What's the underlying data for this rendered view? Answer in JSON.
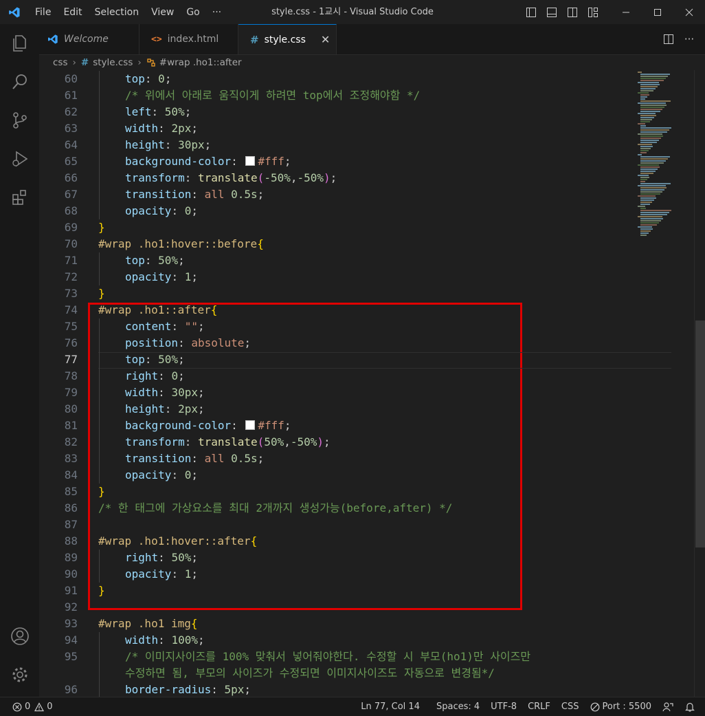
{
  "titlebar": {
    "menu": [
      "File",
      "Edit",
      "Selection",
      "View",
      "Go",
      "···"
    ],
    "window_title": "style.css - 1교시 - Visual Studio Code"
  },
  "tabs": [
    {
      "label": "Welcome",
      "icon": "vscode-logo-icon",
      "italic": true
    },
    {
      "label": "index.html",
      "icon": "html-file-icon"
    },
    {
      "label": "style.css",
      "icon": "css-file-icon",
      "active": true,
      "close": "✕"
    }
  ],
  "breadcrumb": {
    "folder": "css",
    "file": "style.css",
    "symbol": "#wrap .ho1::after"
  },
  "status": {
    "errors": "0",
    "warnings": "0",
    "position": "Ln 77, Col 14",
    "spaces": "Spaces: 4",
    "encoding": "UTF-8",
    "eol": "CRLF",
    "language": "CSS",
    "port": "Port : 5500"
  },
  "code": [
    {
      "n": "60",
      "indent": 1,
      "t": [
        [
          "prop",
          "top"
        ],
        [
          "p",
          ": "
        ],
        [
          "num",
          "0"
        ],
        [
          "p",
          ";"
        ]
      ]
    },
    {
      "n": "61",
      "indent": 1,
      "t": [
        [
          "com",
          "/* 위에서 아래로 움직이게 하려면 top에서 조정해야함 */"
        ]
      ]
    },
    {
      "n": "62",
      "indent": 1,
      "t": [
        [
          "prop",
          "left"
        ],
        [
          "p",
          ": "
        ],
        [
          "num",
          "50%"
        ],
        [
          "p",
          ";"
        ]
      ]
    },
    {
      "n": "63",
      "indent": 1,
      "t": [
        [
          "prop",
          "width"
        ],
        [
          "p",
          ": "
        ],
        [
          "num",
          "2px"
        ],
        [
          "p",
          ";"
        ]
      ]
    },
    {
      "n": "64",
      "indent": 1,
      "t": [
        [
          "prop",
          "height"
        ],
        [
          "p",
          ": "
        ],
        [
          "num",
          "30px"
        ],
        [
          "p",
          ";"
        ]
      ]
    },
    {
      "n": "65",
      "indent": 1,
      "t": [
        [
          "prop",
          "background-color"
        ],
        [
          "p",
          ": "
        ],
        [
          "swatch",
          ""
        ],
        [
          "str",
          "#fff"
        ],
        [
          "p",
          ";"
        ]
      ]
    },
    {
      "n": "66",
      "indent": 1,
      "t": [
        [
          "prop",
          "transform"
        ],
        [
          "p",
          ": "
        ],
        [
          "fn",
          "translate"
        ],
        [
          "br2",
          "("
        ],
        [
          "num",
          "-50%"
        ],
        [
          "p",
          ","
        ],
        [
          "num",
          "-50%"
        ],
        [
          "br2",
          ")"
        ],
        [
          "p",
          ";"
        ]
      ]
    },
    {
      "n": "67",
      "indent": 1,
      "t": [
        [
          "prop",
          "transition"
        ],
        [
          "p",
          ": "
        ],
        [
          "str",
          "all"
        ],
        [
          "p",
          " "
        ],
        [
          "num",
          "0.5s"
        ],
        [
          "p",
          ";"
        ]
      ]
    },
    {
      "n": "68",
      "indent": 1,
      "t": [
        [
          "prop",
          "opacity"
        ],
        [
          "p",
          ": "
        ],
        [
          "num",
          "0"
        ],
        [
          "p",
          ";"
        ]
      ]
    },
    {
      "n": "69",
      "indent": 0,
      "t": [
        [
          "br1",
          "}"
        ]
      ]
    },
    {
      "n": "70",
      "indent": 0,
      "t": [
        [
          "sel",
          "#wrap .ho1:hover::before"
        ],
        [
          "br1",
          "{"
        ]
      ]
    },
    {
      "n": "71",
      "indent": 1,
      "t": [
        [
          "prop",
          "top"
        ],
        [
          "p",
          ": "
        ],
        [
          "num",
          "50%"
        ],
        [
          "p",
          ";"
        ]
      ]
    },
    {
      "n": "72",
      "indent": 1,
      "t": [
        [
          "prop",
          "opacity"
        ],
        [
          "p",
          ": "
        ],
        [
          "num",
          "1"
        ],
        [
          "p",
          ";"
        ]
      ]
    },
    {
      "n": "73",
      "indent": 0,
      "t": [
        [
          "br1",
          "}"
        ]
      ]
    },
    {
      "n": "74",
      "indent": 0,
      "t": [
        [
          "sel",
          "#wrap .ho1::after"
        ],
        [
          "br1",
          "{"
        ]
      ]
    },
    {
      "n": "75",
      "indent": 1,
      "t": [
        [
          "prop",
          "content"
        ],
        [
          "p",
          ": "
        ],
        [
          "str",
          "\"\""
        ],
        [
          "p",
          ";"
        ]
      ]
    },
    {
      "n": "76",
      "indent": 1,
      "t": [
        [
          "prop",
          "position"
        ],
        [
          "p",
          ": "
        ],
        [
          "str",
          "absolute"
        ],
        [
          "p",
          ";"
        ]
      ]
    },
    {
      "n": "77",
      "indent": 1,
      "cur": true,
      "t": [
        [
          "prop",
          "top"
        ],
        [
          "p",
          ": "
        ],
        [
          "num",
          "50%"
        ],
        [
          "p",
          ";"
        ]
      ]
    },
    {
      "n": "78",
      "indent": 1,
      "t": [
        [
          "prop",
          "right"
        ],
        [
          "p",
          ": "
        ],
        [
          "num",
          "0"
        ],
        [
          "p",
          ";"
        ]
      ]
    },
    {
      "n": "79",
      "indent": 1,
      "t": [
        [
          "prop",
          "width"
        ],
        [
          "p",
          ": "
        ],
        [
          "num",
          "30px"
        ],
        [
          "p",
          ";"
        ]
      ]
    },
    {
      "n": "80",
      "indent": 1,
      "t": [
        [
          "prop",
          "height"
        ],
        [
          "p",
          ": "
        ],
        [
          "num",
          "2px"
        ],
        [
          "p",
          ";"
        ]
      ]
    },
    {
      "n": "81",
      "indent": 1,
      "t": [
        [
          "prop",
          "background-color"
        ],
        [
          "p",
          ": "
        ],
        [
          "swatch",
          ""
        ],
        [
          "str",
          "#fff"
        ],
        [
          "p",
          ";"
        ]
      ]
    },
    {
      "n": "82",
      "indent": 1,
      "t": [
        [
          "prop",
          "transform"
        ],
        [
          "p",
          ": "
        ],
        [
          "fn",
          "translate"
        ],
        [
          "br2",
          "("
        ],
        [
          "num",
          "50%"
        ],
        [
          "p",
          ","
        ],
        [
          "num",
          "-50%"
        ],
        [
          "br2",
          ")"
        ],
        [
          "p",
          ";"
        ]
      ]
    },
    {
      "n": "83",
      "indent": 1,
      "t": [
        [
          "prop",
          "transition"
        ],
        [
          "p",
          ": "
        ],
        [
          "str",
          "all"
        ],
        [
          "p",
          " "
        ],
        [
          "num",
          "0.5s"
        ],
        [
          "p",
          ";"
        ]
      ]
    },
    {
      "n": "84",
      "indent": 1,
      "t": [
        [
          "prop",
          "opacity"
        ],
        [
          "p",
          ": "
        ],
        [
          "num",
          "0"
        ],
        [
          "p",
          ";"
        ]
      ]
    },
    {
      "n": "85",
      "indent": 0,
      "t": [
        [
          "br1",
          "}"
        ]
      ]
    },
    {
      "n": "86",
      "indent": 0,
      "t": [
        [
          "com",
          "/* 한 태그에 가상요소를 최대 2개까지 생성가능(before,after) */"
        ]
      ]
    },
    {
      "n": "87",
      "indent": 0,
      "t": []
    },
    {
      "n": "88",
      "indent": 0,
      "t": [
        [
          "sel",
          "#wrap .ho1:hover::after"
        ],
        [
          "br1",
          "{"
        ]
      ]
    },
    {
      "n": "89",
      "indent": 1,
      "t": [
        [
          "prop",
          "right"
        ],
        [
          "p",
          ": "
        ],
        [
          "num",
          "50%"
        ],
        [
          "p",
          ";"
        ]
      ]
    },
    {
      "n": "90",
      "indent": 1,
      "t": [
        [
          "prop",
          "opacity"
        ],
        [
          "p",
          ": "
        ],
        [
          "num",
          "1"
        ],
        [
          "p",
          ";"
        ]
      ]
    },
    {
      "n": "91",
      "indent": 0,
      "t": [
        [
          "br1",
          "}"
        ]
      ]
    },
    {
      "n": "92",
      "indent": 0,
      "t": []
    },
    {
      "n": "93",
      "indent": 0,
      "t": [
        [
          "sel",
          "#wrap .ho1 img"
        ],
        [
          "br1",
          "{"
        ]
      ]
    },
    {
      "n": "94",
      "indent": 1,
      "t": [
        [
          "prop",
          "width"
        ],
        [
          "p",
          ": "
        ],
        [
          "num",
          "100%"
        ],
        [
          "p",
          ";"
        ]
      ]
    },
    {
      "n": "95",
      "indent": 1,
      "t": [
        [
          "com",
          "/* 이미지사이즈를 100% 맞춰서 넣어줘야한다. 수정할 시 부모(ho1)만 사이즈만"
        ]
      ]
    },
    {
      "n": "",
      "indent": 1,
      "t": [
        [
          "com",
          "수정하면 됨, 부모의 사이즈가 수정되면 이미지사이즈도 자동으로 변경됨*/"
        ]
      ]
    },
    {
      "n": "96",
      "indent": 1,
      "t": [
        [
          "prop",
          "border-radius"
        ],
        [
          "p",
          ": "
        ],
        [
          "num",
          "5px"
        ],
        [
          "p",
          ";"
        ]
      ]
    }
  ],
  "colors": {
    "accent": "#0078d4",
    "highlight_box": "#e00000"
  }
}
